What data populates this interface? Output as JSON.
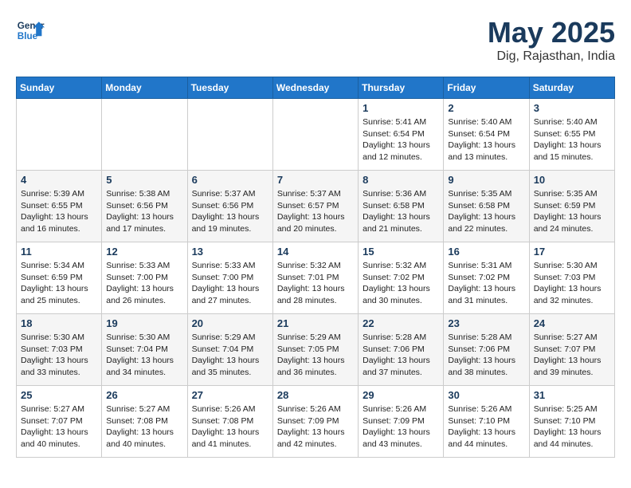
{
  "header": {
    "logo_line1": "General",
    "logo_line2": "Blue",
    "month": "May 2025",
    "location": "Dig, Rajasthan, India"
  },
  "days_of_week": [
    "Sunday",
    "Monday",
    "Tuesday",
    "Wednesday",
    "Thursday",
    "Friday",
    "Saturday"
  ],
  "weeks": [
    [
      {
        "day": "",
        "info": ""
      },
      {
        "day": "",
        "info": ""
      },
      {
        "day": "",
        "info": ""
      },
      {
        "day": "",
        "info": ""
      },
      {
        "day": "1",
        "info": "Sunrise: 5:41 AM\nSunset: 6:54 PM\nDaylight: 13 hours\nand 12 minutes."
      },
      {
        "day": "2",
        "info": "Sunrise: 5:40 AM\nSunset: 6:54 PM\nDaylight: 13 hours\nand 13 minutes."
      },
      {
        "day": "3",
        "info": "Sunrise: 5:40 AM\nSunset: 6:55 PM\nDaylight: 13 hours\nand 15 minutes."
      }
    ],
    [
      {
        "day": "4",
        "info": "Sunrise: 5:39 AM\nSunset: 6:55 PM\nDaylight: 13 hours\nand 16 minutes."
      },
      {
        "day": "5",
        "info": "Sunrise: 5:38 AM\nSunset: 6:56 PM\nDaylight: 13 hours\nand 17 minutes."
      },
      {
        "day": "6",
        "info": "Sunrise: 5:37 AM\nSunset: 6:56 PM\nDaylight: 13 hours\nand 19 minutes."
      },
      {
        "day": "7",
        "info": "Sunrise: 5:37 AM\nSunset: 6:57 PM\nDaylight: 13 hours\nand 20 minutes."
      },
      {
        "day": "8",
        "info": "Sunrise: 5:36 AM\nSunset: 6:58 PM\nDaylight: 13 hours\nand 21 minutes."
      },
      {
        "day": "9",
        "info": "Sunrise: 5:35 AM\nSunset: 6:58 PM\nDaylight: 13 hours\nand 22 minutes."
      },
      {
        "day": "10",
        "info": "Sunrise: 5:35 AM\nSunset: 6:59 PM\nDaylight: 13 hours\nand 24 minutes."
      }
    ],
    [
      {
        "day": "11",
        "info": "Sunrise: 5:34 AM\nSunset: 6:59 PM\nDaylight: 13 hours\nand 25 minutes."
      },
      {
        "day": "12",
        "info": "Sunrise: 5:33 AM\nSunset: 7:00 PM\nDaylight: 13 hours\nand 26 minutes."
      },
      {
        "day": "13",
        "info": "Sunrise: 5:33 AM\nSunset: 7:00 PM\nDaylight: 13 hours\nand 27 minutes."
      },
      {
        "day": "14",
        "info": "Sunrise: 5:32 AM\nSunset: 7:01 PM\nDaylight: 13 hours\nand 28 minutes."
      },
      {
        "day": "15",
        "info": "Sunrise: 5:32 AM\nSunset: 7:02 PM\nDaylight: 13 hours\nand 30 minutes."
      },
      {
        "day": "16",
        "info": "Sunrise: 5:31 AM\nSunset: 7:02 PM\nDaylight: 13 hours\nand 31 minutes."
      },
      {
        "day": "17",
        "info": "Sunrise: 5:30 AM\nSunset: 7:03 PM\nDaylight: 13 hours\nand 32 minutes."
      }
    ],
    [
      {
        "day": "18",
        "info": "Sunrise: 5:30 AM\nSunset: 7:03 PM\nDaylight: 13 hours\nand 33 minutes."
      },
      {
        "day": "19",
        "info": "Sunrise: 5:30 AM\nSunset: 7:04 PM\nDaylight: 13 hours\nand 34 minutes."
      },
      {
        "day": "20",
        "info": "Sunrise: 5:29 AM\nSunset: 7:04 PM\nDaylight: 13 hours\nand 35 minutes."
      },
      {
        "day": "21",
        "info": "Sunrise: 5:29 AM\nSunset: 7:05 PM\nDaylight: 13 hours\nand 36 minutes."
      },
      {
        "day": "22",
        "info": "Sunrise: 5:28 AM\nSunset: 7:06 PM\nDaylight: 13 hours\nand 37 minutes."
      },
      {
        "day": "23",
        "info": "Sunrise: 5:28 AM\nSunset: 7:06 PM\nDaylight: 13 hours\nand 38 minutes."
      },
      {
        "day": "24",
        "info": "Sunrise: 5:27 AM\nSunset: 7:07 PM\nDaylight: 13 hours\nand 39 minutes."
      }
    ],
    [
      {
        "day": "25",
        "info": "Sunrise: 5:27 AM\nSunset: 7:07 PM\nDaylight: 13 hours\nand 40 minutes."
      },
      {
        "day": "26",
        "info": "Sunrise: 5:27 AM\nSunset: 7:08 PM\nDaylight: 13 hours\nand 40 minutes."
      },
      {
        "day": "27",
        "info": "Sunrise: 5:26 AM\nSunset: 7:08 PM\nDaylight: 13 hours\nand 41 minutes."
      },
      {
        "day": "28",
        "info": "Sunrise: 5:26 AM\nSunset: 7:09 PM\nDaylight: 13 hours\nand 42 minutes."
      },
      {
        "day": "29",
        "info": "Sunrise: 5:26 AM\nSunset: 7:09 PM\nDaylight: 13 hours\nand 43 minutes."
      },
      {
        "day": "30",
        "info": "Sunrise: 5:26 AM\nSunset: 7:10 PM\nDaylight: 13 hours\nand 44 minutes."
      },
      {
        "day": "31",
        "info": "Sunrise: 5:25 AM\nSunset: 7:10 PM\nDaylight: 13 hours\nand 44 minutes."
      }
    ]
  ]
}
